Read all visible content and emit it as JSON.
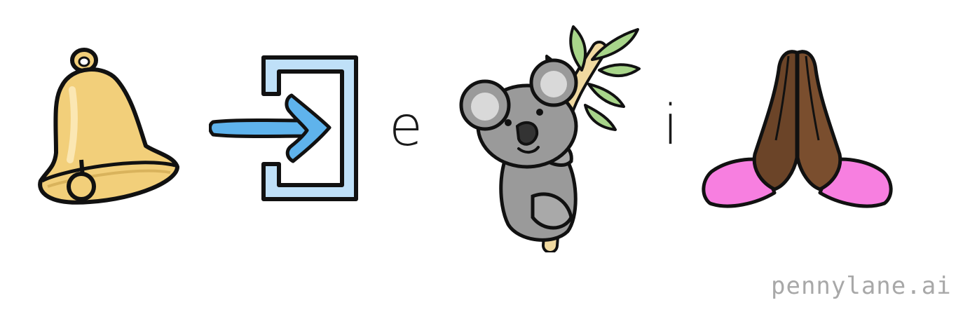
{
  "puzzle": {
    "pictograms": [
      {
        "icon": "bell-icon"
      },
      {
        "icon": "enter-arrow-icon"
      },
      {
        "letter": "e"
      },
      {
        "icon": "koala-icon"
      },
      {
        "letter": "i"
      },
      {
        "icon": "folded-hands-icon"
      }
    ],
    "letter_1": "e",
    "letter_2": "i"
  },
  "watermark": {
    "text": "pennylane.ai"
  },
  "colors": {
    "bell": "#f2cf7a",
    "enter_arrow": "#5fb3ec",
    "koala": "#9a9a9a",
    "eucalyptus": "#a8d58a",
    "hands": "#6b4428",
    "sleeves": "#f77fe0"
  }
}
